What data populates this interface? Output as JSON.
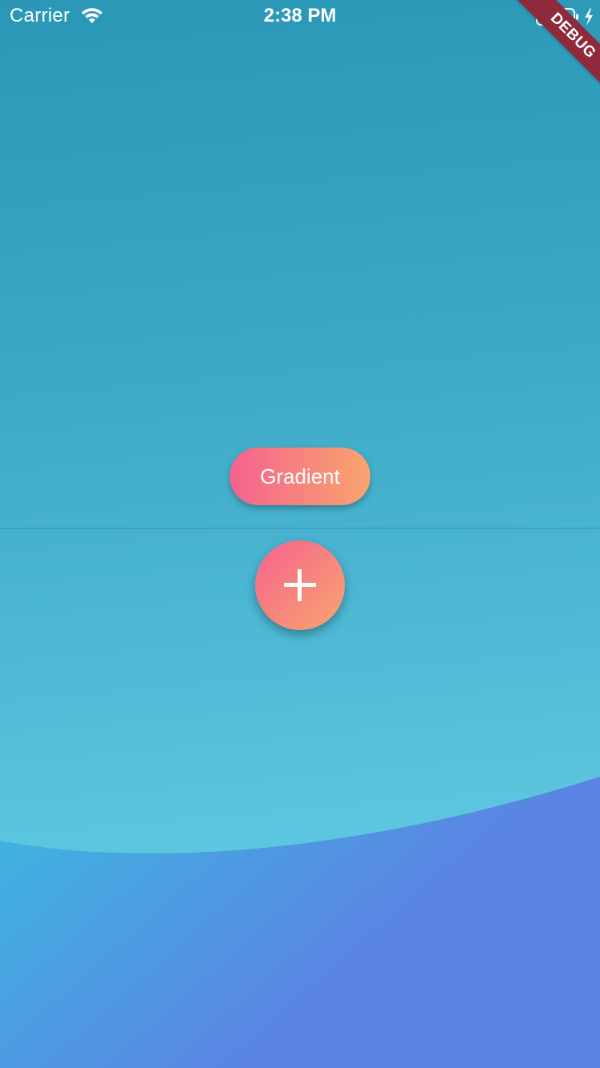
{
  "status_bar": {
    "carrier": "Carrier",
    "time": "2:38 PM",
    "icons": [
      "wifi-icon",
      "battery-icon",
      "charging-bolt-icon"
    ]
  },
  "debug_banner": {
    "label": "DEBUG",
    "color": "#8e2a3b"
  },
  "main": {
    "gradient_button_label": "Gradient",
    "fab_icon": "plus-icon"
  },
  "colors": {
    "background_top": "#2a97b6",
    "background_bottom": "#5fc8e0",
    "wave_left": "#3cb9e0",
    "wave_right": "#5b83e3",
    "button_gradient_start": "#f5628f",
    "button_gradient_end": "#f8a56e",
    "battery_fill": "#4cd964"
  }
}
